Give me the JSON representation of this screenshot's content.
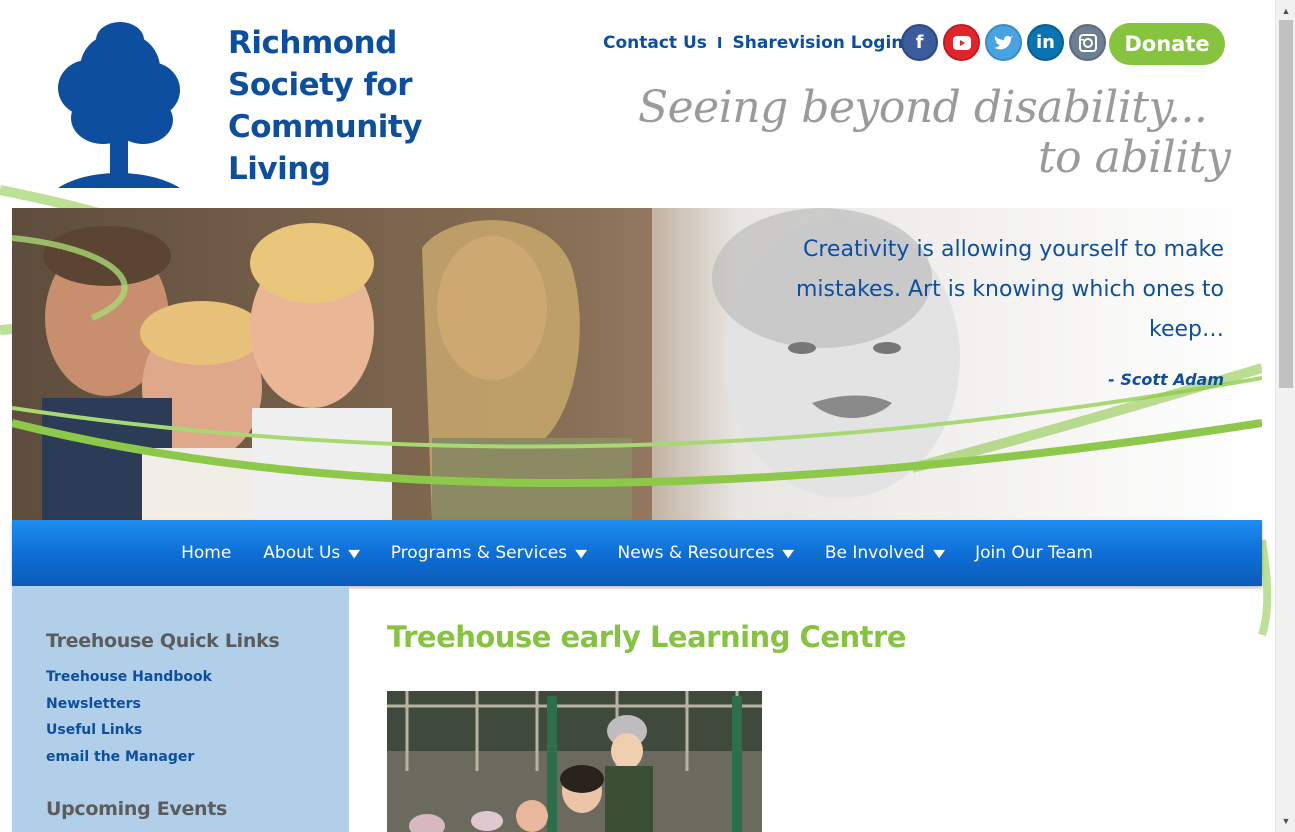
{
  "header": {
    "org_name": [
      "Richmond",
      "Society for",
      "Community",
      "Living"
    ],
    "top_links": [
      "Contact Us",
      "Sharevision Login"
    ],
    "separator": "I",
    "social_icons": [
      "facebook-icon",
      "youtube-icon",
      "twitter-icon",
      "linkedin-icon",
      "instagram-icon"
    ],
    "donate_label": "Donate",
    "tagline_line1": "Seeing beyond disability...",
    "tagline_line2": "to ability"
  },
  "hero": {
    "quote": "Creativity is allowing yourself to make mistakes. Art is knowing which ones to keep…",
    "author": "- Scott Adam"
  },
  "nav": {
    "items": [
      {
        "label": "Home",
        "dropdown": false
      },
      {
        "label": "About Us",
        "dropdown": true
      },
      {
        "label": "Programs & Services",
        "dropdown": true
      },
      {
        "label": "News & Resources",
        "dropdown": true
      },
      {
        "label": "Be Involved",
        "dropdown": true
      },
      {
        "label": "Join Our Team",
        "dropdown": false
      }
    ]
  },
  "sidebar": {
    "quick_links_title": "Treehouse Quick Links",
    "links": [
      "Treehouse Handbook",
      "Newsletters",
      "Useful Links",
      "email the Manager"
    ],
    "events_title": "Upcoming Events"
  },
  "main": {
    "title": "Treehouse early Learning Centre"
  },
  "colors": {
    "brand_blue": "#0d4f9e",
    "brand_green": "#86c440",
    "nav_blue": "#0f6fd6",
    "sidebar_bg": "#b2cfe9"
  }
}
